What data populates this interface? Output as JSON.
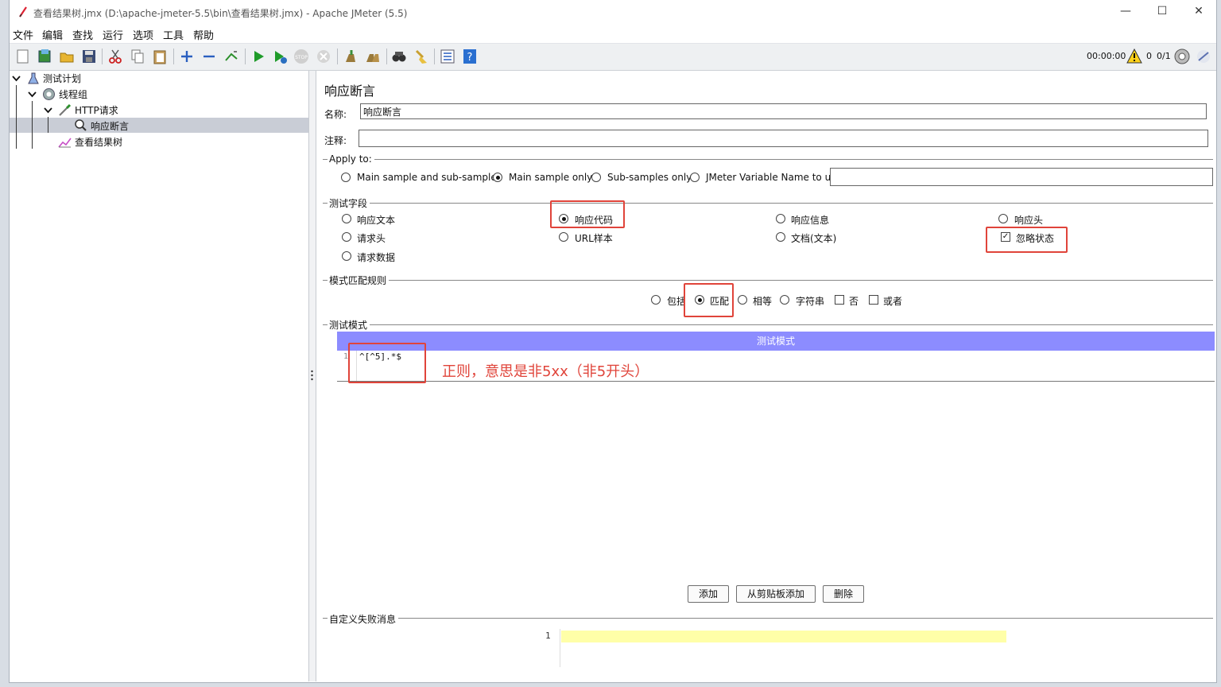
{
  "window": {
    "title": "查看结果树.jmx (D:\\apache-jmeter-5.5\\bin\\查看结果树.jmx) - Apache JMeter (5.5)",
    "minimize": "—",
    "maximize": "☐",
    "close": "✕"
  },
  "menu": [
    "文件",
    "编辑",
    "查找",
    "运行",
    "选项",
    "工具",
    "帮助"
  ],
  "status": {
    "timer": "00:00:00",
    "warnings": "0",
    "threads": "0/1"
  },
  "tree": {
    "items": [
      {
        "label": "测试计划"
      },
      {
        "label": "线程组"
      },
      {
        "label": "HTTP请求"
      },
      {
        "label": "响应断言"
      },
      {
        "label": "查看结果树"
      }
    ]
  },
  "panel": {
    "title": "响应断言",
    "name_label": "名称:",
    "name_value": "响应断言",
    "comment_label": "注释:",
    "comment_value": "",
    "apply_to": {
      "label": "Apply to:",
      "options": [
        "Main sample and sub-samples",
        "Main sample only",
        "Sub-samples only",
        "JMeter Variable Name to use"
      ],
      "selected": "Main sample only",
      "variable_value": ""
    },
    "field_to_test": {
      "label": "测试字段",
      "options": [
        "响应文本",
        "响应代码",
        "响应信息",
        "响应头",
        "请求头",
        "URL样本",
        "文档(文本)",
        "请求数据"
      ],
      "selected": "响应代码",
      "ignore_status_label": "忽略状态",
      "ignore_status_checked": true
    },
    "pattern_matching": {
      "label": "模式匹配规则",
      "options": [
        "包括",
        "匹配",
        "相等",
        "字符串"
      ],
      "selected": "匹配",
      "not_label": "否",
      "or_label": "或者"
    },
    "patterns": {
      "label": "测试模式",
      "column": "测试模式",
      "rows": [
        {
          "line": "1",
          "value": "^[^5].*$"
        }
      ],
      "annotation": "正则，意思是非5xx（非5开头）"
    },
    "buttons": {
      "add": "添加",
      "add_from_clipboard": "从剪贴板添加",
      "delete": "删除"
    },
    "custom_failure": {
      "label": "自定义失败消息",
      "line": "1",
      "value": ""
    }
  },
  "colors": {
    "table_header": "#8c8cff",
    "highlight_box": "#e0443a",
    "annotation": "#e0443a",
    "editor_line": "#ffffa8"
  }
}
